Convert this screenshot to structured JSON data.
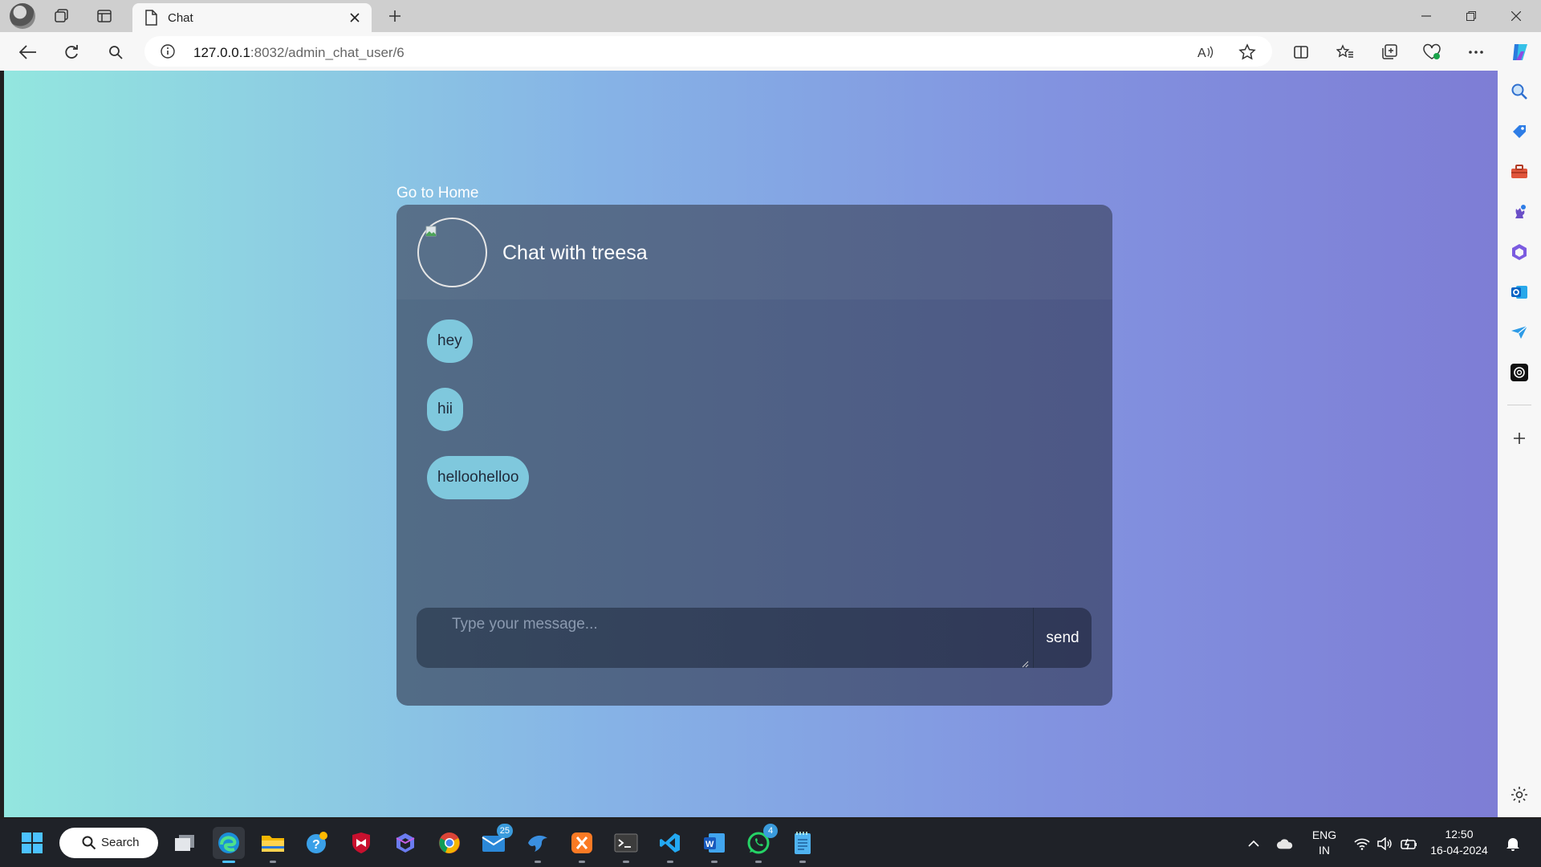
{
  "browser": {
    "tab_title": "Chat",
    "url_host": "127.0.0.1",
    "url_rest": ":8032/admin_chat_user/6"
  },
  "page": {
    "home_link": "Go to Home",
    "chat_title": "Chat with treesa",
    "messages": [
      {
        "text": "hey"
      },
      {
        "text": "hii"
      },
      {
        "text": "helloohelloo"
      }
    ],
    "input_placeholder": "Type your message...",
    "send_label": "send"
  },
  "taskbar": {
    "search_label": "Search",
    "mail_badge": "25",
    "whatsapp_badge": "4",
    "lang_line1": "ENG",
    "lang_line2": "IN",
    "time": "12:50",
    "date": "16-04-2024"
  },
  "colors": {
    "gradient_start": "#93e6df",
    "gradient_end": "#7e7dd5",
    "card": "#506080",
    "bubble": "#7fc8dd"
  }
}
